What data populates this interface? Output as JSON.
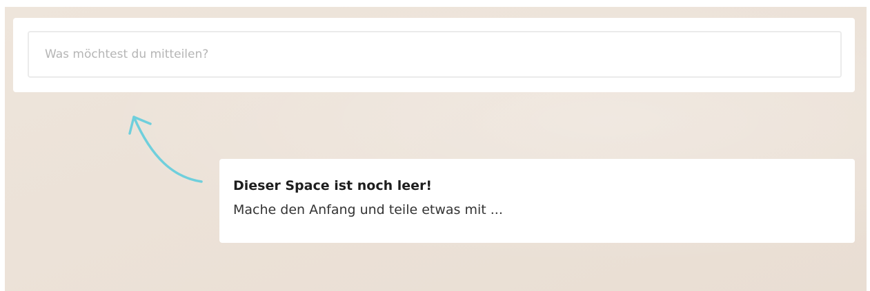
{
  "composer": {
    "placeholder": "Was möchtest du mitteilen?",
    "value": ""
  },
  "hint": {
    "arrow_icon": "curved-arrow-up-left-icon",
    "arrow_color": "#6fcfdc"
  },
  "empty_state": {
    "title": "Dieser Space ist noch leer!",
    "text": "Mache den Anfang und teile etwas mit ..."
  }
}
